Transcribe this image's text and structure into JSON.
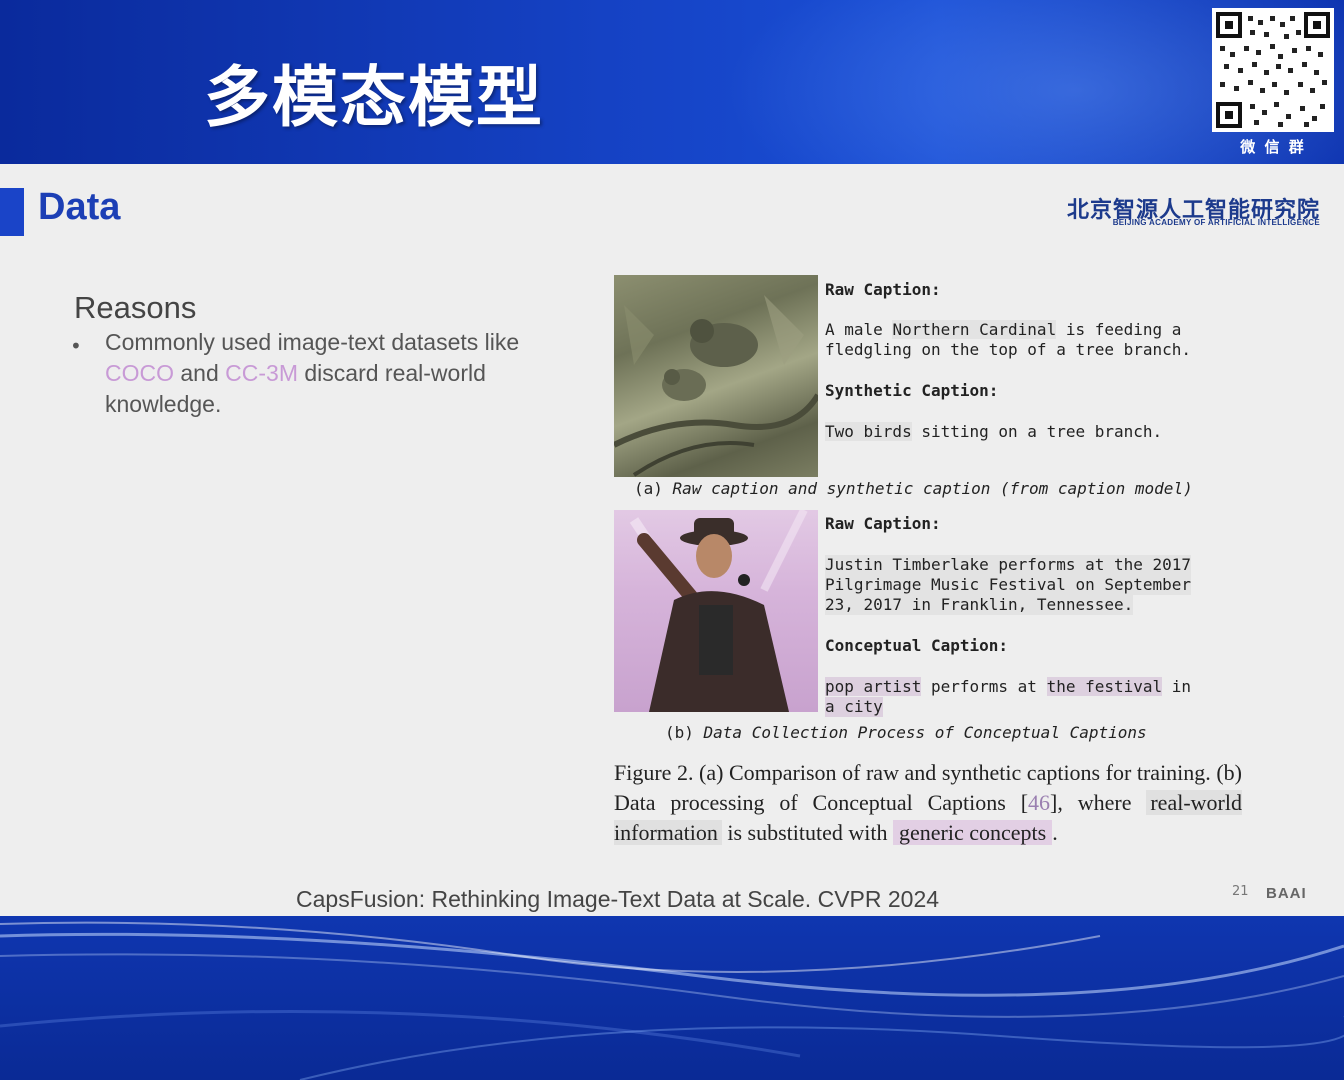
{
  "banner": {
    "title": "多模态模型",
    "qr_caption": "微 信 群"
  },
  "slide": {
    "title": "Data",
    "institution_cn": "北京智源人工智能研究院",
    "institution_en": "BEIJING ACADEMY OF ARTIFICIAL INTELLIGENCE",
    "reasons_heading": "Reasons",
    "bullet_symbol": "•",
    "reasons_text": {
      "part1": "Commonly used image-text datasets like ",
      "coco": "COCO",
      "part2": " and ",
      "cc3m": "CC-3M",
      "part3": " discard real-world knowledge."
    },
    "figure": {
      "a": {
        "raw_label": "Raw Caption:",
        "raw_l1_pre": "A male ",
        "raw_l1_hl": "Northern Cardinal",
        "raw_l1_post": " is feeding a",
        "raw_l2": "fledgling on the top of a tree branch.",
        "syn_label": "Synthetic Caption:",
        "syn_hl": "Two birds",
        "syn_post": " sitting on a tree branch.",
        "subcaption_prefix": "(a) ",
        "subcaption": "Raw caption and synthetic caption (from caption model)"
      },
      "b": {
        "raw_label": "Raw Caption:",
        "raw_l1": "Justin Timberlake performs at the 2017",
        "raw_l2": "Pilgrimage Music Festival on September",
        "raw_l3": "23, 2017 in Franklin, Tennessee.",
        "concept_label": "Conceptual Caption:",
        "concept_hl1": "pop artist",
        "concept_mid": " performs at ",
        "concept_hl2": "the festival",
        "concept_post": " in",
        "concept_l2": "a city",
        "subcaption_prefix": "(b) ",
        "subcaption": "Data Collection Process of Conceptual Captions"
      },
      "caption": {
        "part1": "Figure 2.  (a) Comparison of raw and synthetic captions for training.  (b) Data processing of Conceptual Captions ",
        "cite_open": "[",
        "cite": "46",
        "cite_close": "]",
        "part2": ", where ",
        "real_world": "real-world information",
        "part3": " is substituted with ",
        "generic": "generic concepts",
        "part4": "."
      }
    },
    "footer_reference": "CapsFusion: Rethinking Image-Text Data at Scale. CVPR 2024",
    "page_number": "21",
    "baai_logo_text": "BAAI"
  },
  "colors": {
    "banner_blue": "#1542c4",
    "title_blue": "#1c3fb5",
    "highlight_purple": "#c89ad6"
  }
}
